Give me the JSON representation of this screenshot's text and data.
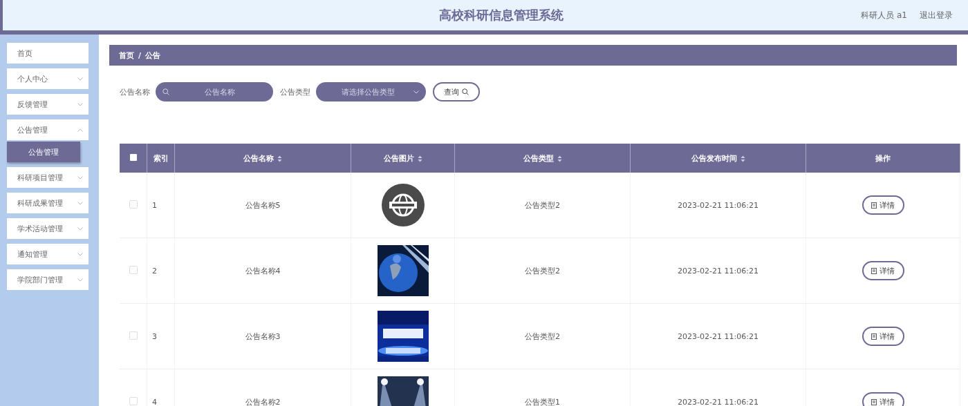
{
  "header": {
    "title": "高校科研信息管理系统",
    "user": "科研人员 a1",
    "logout": "退出登录"
  },
  "sidebar": {
    "items": [
      {
        "label": "首页",
        "kind": "link"
      },
      {
        "label": "个人中心",
        "kind": "menu",
        "expanded": false
      },
      {
        "label": "反馈管理",
        "kind": "menu",
        "expanded": false
      },
      {
        "label": "公告管理",
        "kind": "menu",
        "expanded": true,
        "children": [
          {
            "label": "公告管理",
            "selected": true
          }
        ]
      },
      {
        "label": "科研项目管理",
        "kind": "menu",
        "expanded": false
      },
      {
        "label": "科研成果管理",
        "kind": "menu",
        "expanded": false
      },
      {
        "label": "学术活动管理",
        "kind": "menu",
        "expanded": false
      },
      {
        "label": "通知管理",
        "kind": "menu",
        "expanded": false
      },
      {
        "label": "学院部门管理",
        "kind": "menu",
        "expanded": false
      }
    ]
  },
  "breadcrumb": {
    "items": [
      "首页",
      "公告"
    ],
    "separator": "/"
  },
  "search": {
    "name_label": "公告名称",
    "name_placeholder": "公告名称",
    "type_label": "公告类型",
    "type_placeholder": "请选择公告类型",
    "button": "查询"
  },
  "table": {
    "select_all_checked": false,
    "columns": [
      {
        "kind": "check"
      },
      {
        "label": "索引",
        "kind": "index"
      },
      {
        "label": "公告名称",
        "kind": "text",
        "sortable": true
      },
      {
        "label": "公告图片",
        "kind": "picture",
        "sortable": true
      },
      {
        "label": "公告类型",
        "kind": "text",
        "sortable": true
      },
      {
        "label": "公告发布时间",
        "kind": "text",
        "sortable": true
      },
      {
        "label": "操作",
        "kind": "action"
      }
    ],
    "rows": [
      {
        "checked": false,
        "index": "1",
        "name": "公告名称5",
        "type": "公告类型2",
        "time": "2023-02-21 11:06:21",
        "action": "详情"
      },
      {
        "checked": false,
        "index": "2",
        "name": "公告名称4",
        "type": "公告类型2",
        "time": "2023-02-21 11:06:21",
        "action": "详情"
      },
      {
        "checked": false,
        "index": "3",
        "name": "公告名称3",
        "type": "公告类型2",
        "time": "2023-02-21 11:06:21",
        "action": "详情"
      },
      {
        "checked": false,
        "index": "4",
        "name": "公告名称2",
        "type": "公告类型1",
        "time": "2023-02-21 11:06:21",
        "action": "详情"
      }
    ]
  }
}
